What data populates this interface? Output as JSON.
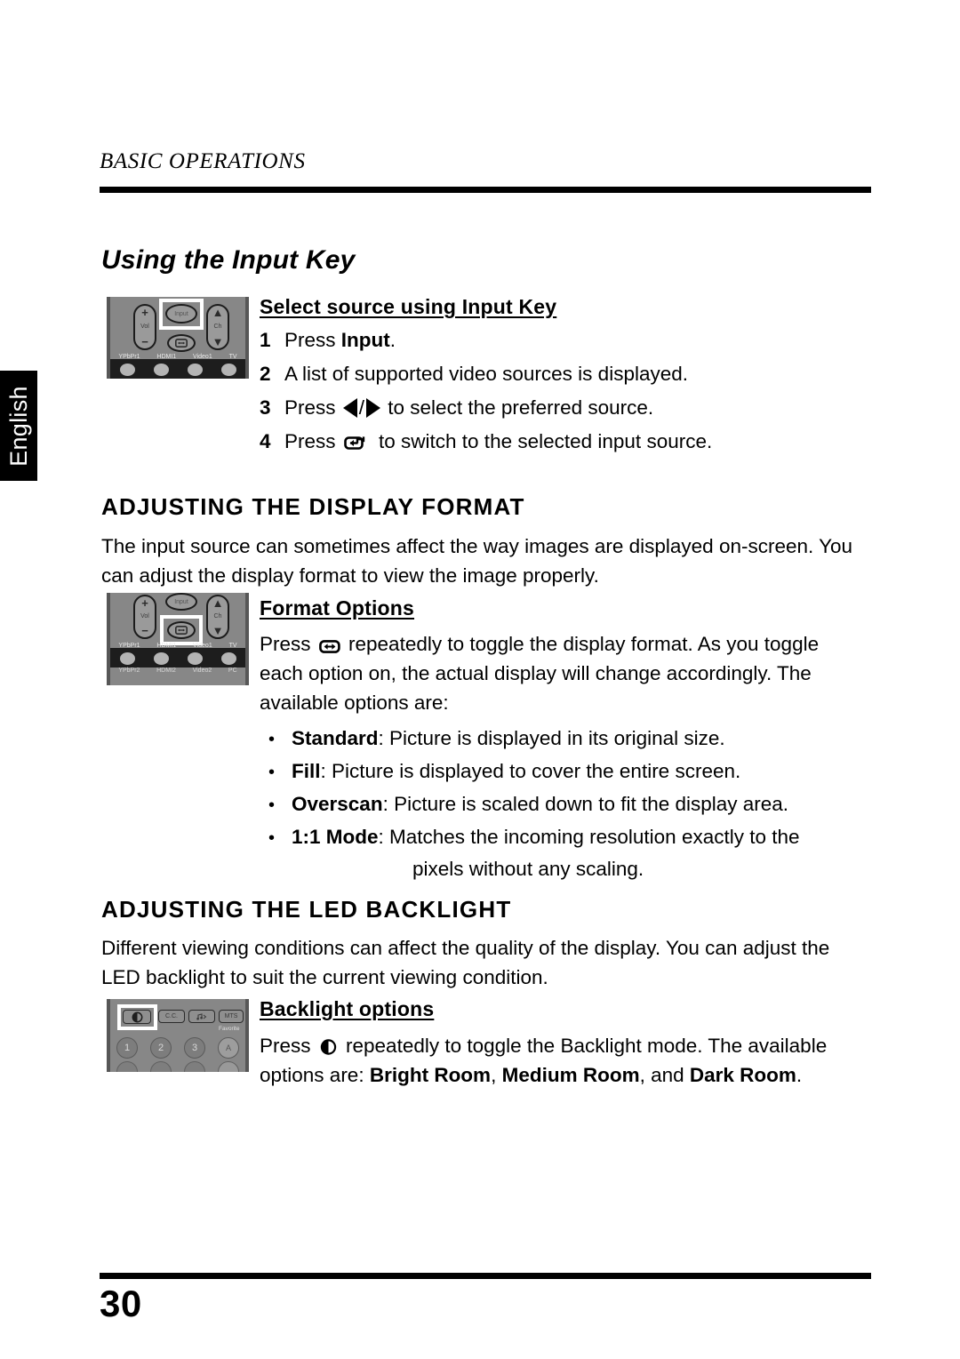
{
  "language_tab": "English",
  "running_head": "BASIC OPERATIONS",
  "page_title": "Using the Input Key",
  "page_number": "30",
  "input_section": {
    "sub_head": "Select source using Input Key",
    "steps": [
      {
        "num": "1",
        "text_before": "Press ",
        "bold": "Input",
        "text_after": "."
      },
      {
        "num": "2",
        "text_before": "A list of supported video sources is displayed.",
        "bold": "",
        "text_after": ""
      },
      {
        "num": "3",
        "text_before": "Press ",
        "bold": "",
        "text_after": " to select the preferred source.",
        "icons": "left-right-arrows"
      },
      {
        "num": "4",
        "text_before": "Press ",
        "bold": "",
        "text_after": " to switch to the selected input source.",
        "icons": "enter-key"
      }
    ]
  },
  "format_section": {
    "heading": "ADJUSTING THE DISPLAY FORMAT",
    "paragraph": "The input source can sometimes affect the way images are displayed on-screen. You can adjust the display format to view the image properly.",
    "sub_head": "Format Options",
    "intro_before": "Press ",
    "intro_after": " repeatedly to toggle the display format. As you toggle each option on, the actual display will change accordingly. The available options are:",
    "options": [
      {
        "term": "Standard",
        "desc": ": Picture is displayed in its original size.",
        "cont": ""
      },
      {
        "term": "Fill",
        "desc": ": Picture is displayed to cover the entire screen.",
        "cont": ""
      },
      {
        "term": "Overscan",
        "desc": ": Picture is scaled down to fit the display area.",
        "cont": ""
      },
      {
        "term": "1:1 Mode",
        "desc": ": Matches the incoming resolution exactly to the",
        "cont": "pixels without any scaling."
      }
    ],
    "bullet_char": "•"
  },
  "backlight_section": {
    "heading": "ADJUSTING THE LED BACKLIGHT",
    "paragraph": "Different viewing conditions can affect the quality of the display. You can adjust the LED backlight to suit the current viewing condition.",
    "sub_head": "Backlight options",
    "intro_before": "Press ",
    "intro_mid": " repeatedly to toggle the Backlight mode. The available options are: ",
    "option1": "Bright Room",
    "sep1": ", ",
    "option2": "Medium Room",
    "sep2": ", and ",
    "option3": "Dark Room",
    "end": "."
  },
  "remote_figures": {
    "input_remote": {
      "vol_label": "Vol",
      "vol_plus": "+",
      "vol_minus": "−",
      "ch_label": "Ch",
      "ch_up": "▲",
      "ch_down": "▼",
      "input_button": "Input",
      "source_labels_row1": [
        "YPbPr1",
        "HDMI1",
        "Video1",
        "TV"
      ]
    },
    "format_remote": {
      "vol_label": "Vol",
      "vol_plus": "+",
      "vol_minus": "−",
      "ch_label": "Ch",
      "ch_up": "▲",
      "ch_down": "▼",
      "input_button": "Input",
      "source_labels_row1": [
        "YPbPr1",
        "HDMI1",
        "Video1",
        "TV"
      ],
      "source_labels_row2": [
        "YPbPr2",
        "HDMI2",
        "Video2",
        "PC"
      ]
    },
    "backlight_remote": {
      "buttons": [
        "",
        "C.C.",
        "",
        "MTS"
      ],
      "favorite_label": "Favorite",
      "number_buttons": [
        "1",
        "2",
        "3",
        "A"
      ]
    }
  },
  "colors": {
    "remote_body": "#878787",
    "remote_edge": "#575757",
    "source_band": "#1d1d1d",
    "highlight": "#ffffff",
    "text": "#000000"
  }
}
